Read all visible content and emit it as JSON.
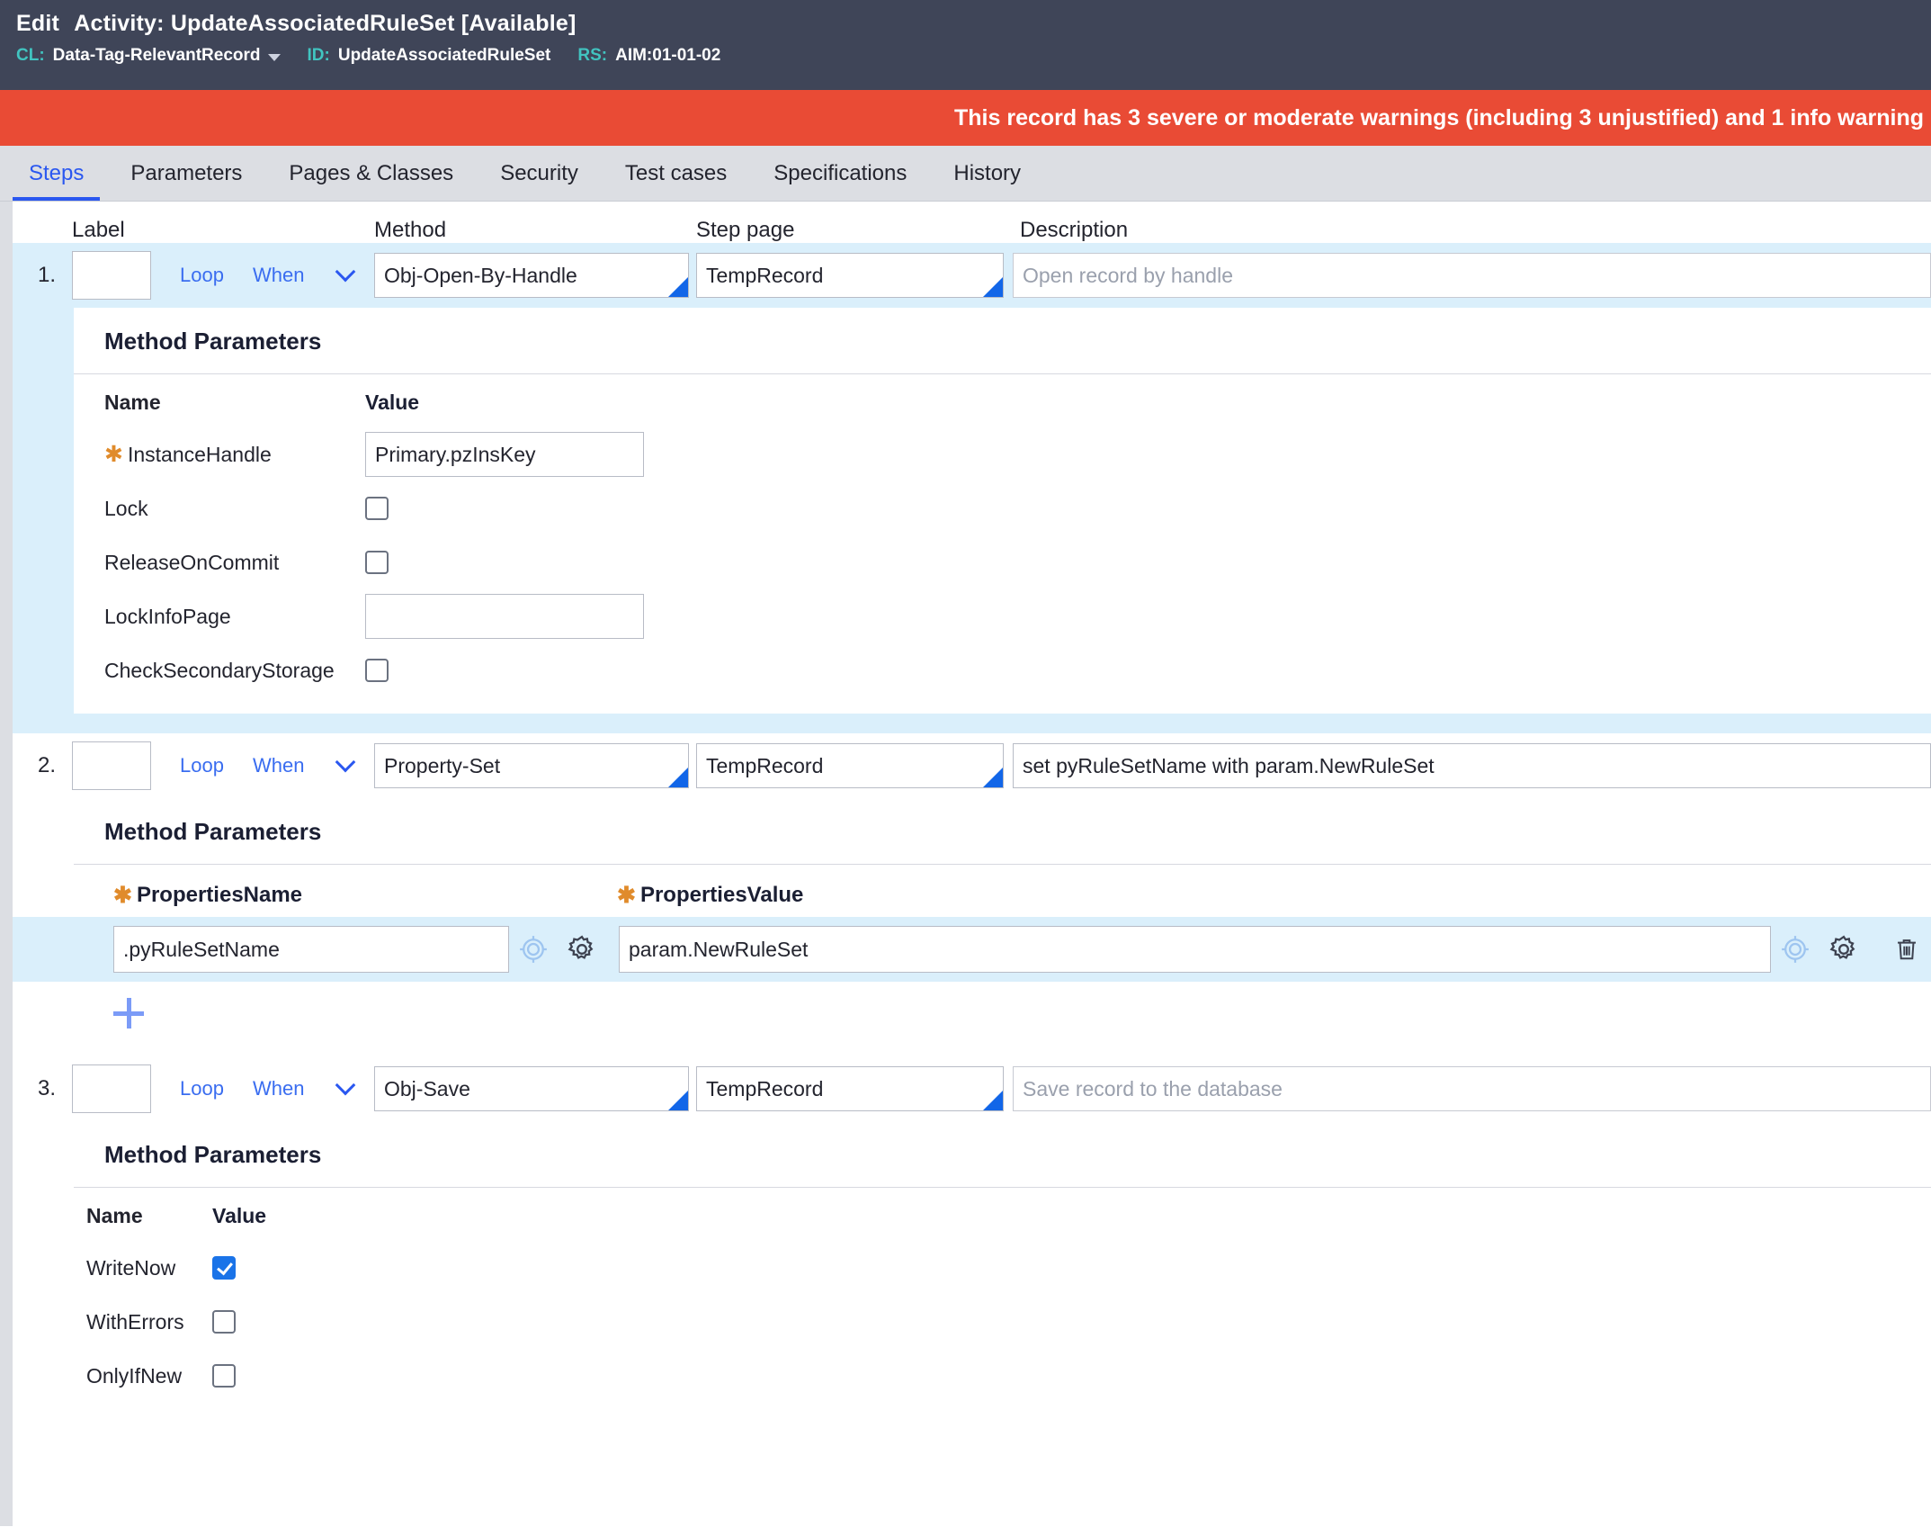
{
  "window": {
    "prefix": "Edit",
    "type": "Activity:",
    "name": "UpdateAssociatedRuleSet",
    "status": "[Available]",
    "meta": [
      {
        "key": "CL:",
        "value": "Data-Tag-RelevantRecord",
        "caret": true
      },
      {
        "key": "ID:",
        "value": "UpdateAssociatedRuleSet",
        "caret": false
      },
      {
        "key": "RS:",
        "value": "AIM:01-01-02",
        "caret": false
      }
    ]
  },
  "banner": {
    "text": "This record has 3 severe or moderate warnings (including 3 unjustified) and 1 info warning",
    "color": "#e94b35"
  },
  "tabs": [
    {
      "label": "Steps",
      "active": true
    },
    {
      "label": "Parameters",
      "active": false
    },
    {
      "label": "Pages & Classes",
      "active": false
    },
    {
      "label": "Security",
      "active": false
    },
    {
      "label": "Test cases",
      "active": false
    },
    {
      "label": "Specifications",
      "active": false
    },
    {
      "label": "History",
      "active": false
    }
  ],
  "columns": {
    "label": "Label",
    "method": "Method",
    "step_page": "Step page",
    "description": "Description"
  },
  "common": {
    "loop": "Loop",
    "when": "When",
    "method_parameters": "Method Parameters",
    "name": "Name",
    "value": "Value",
    "required_star": "★"
  },
  "steps": [
    {
      "num": "1.",
      "label_value": "",
      "method": "Obj-Open-By-Handle",
      "step_page": "TempRecord",
      "description": "",
      "description_placeholder": "Open record by handle",
      "params_title": "Method Parameters",
      "params": [
        {
          "name": "InstanceHandle",
          "required": true,
          "type": "text",
          "value": "Primary.pzInsKey"
        },
        {
          "name": "Lock",
          "required": false,
          "type": "checkbox",
          "checked": false
        },
        {
          "name": "ReleaseOnCommit",
          "required": false,
          "type": "checkbox",
          "checked": false
        },
        {
          "name": "LockInfoPage",
          "required": false,
          "type": "text",
          "value": ""
        },
        {
          "name": "CheckSecondaryStorage",
          "required": false,
          "type": "checkbox",
          "checked": false
        }
      ]
    },
    {
      "num": "2.",
      "label_value": "",
      "method": "Property-Set",
      "step_page": "TempRecord",
      "description": "set pyRuleSetName with param.NewRuleSet",
      "description_placeholder": "",
      "params_title": "Method Parameters",
      "prop_headers": {
        "name": "PropertiesName",
        "value": "PropertiesValue"
      },
      "prop_rows": [
        {
          "name": ".pyRuleSetName",
          "value": "param.NewRuleSet"
        }
      ],
      "add_label": "+"
    },
    {
      "num": "3.",
      "label_value": "",
      "method": "Obj-Save",
      "step_page": "TempRecord",
      "description": "",
      "description_placeholder": "Save record to the database",
      "params_title": "Method Parameters",
      "params": [
        {
          "name": "WriteNow",
          "required": false,
          "type": "checkbox",
          "checked": true
        },
        {
          "name": "WithErrors",
          "required": false,
          "type": "checkbox",
          "checked": false
        },
        {
          "name": "OnlyIfNew",
          "required": false,
          "type": "checkbox",
          "checked": false
        }
      ]
    }
  ],
  "icons": {
    "crosshair": "crosshair-icon",
    "gear": "gear-icon",
    "trash": "trash-icon",
    "add": "plus-icon",
    "chevron": "chevron-down-icon"
  },
  "colors": {
    "header_bg": "#3f4558",
    "accent_teal": "#41c4c0",
    "warning_red": "#e94b35",
    "tab_active": "#2a57f0",
    "highlight_row": "#daeffb",
    "required_star": "#e08b2b",
    "checkbox_checked": "#1a73e8"
  }
}
